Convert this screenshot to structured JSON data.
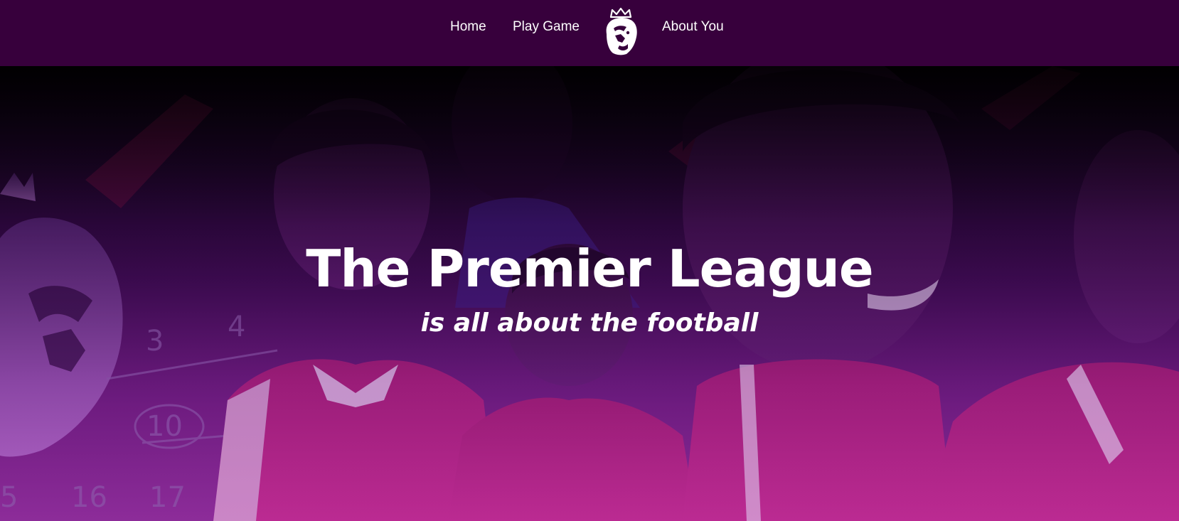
{
  "nav": {
    "home_label": "Home",
    "play_label": "Play Game",
    "about_label": "About You",
    "logo_icon": "premier-league-lion-icon"
  },
  "hero": {
    "title": "The Premier League",
    "subtitle": "is all about the football",
    "background_image": "premier-league-players-collage"
  },
  "colors": {
    "nav_background": "#37003c",
    "overlay_purple": "#6a1a78",
    "text": "#ffffff"
  }
}
